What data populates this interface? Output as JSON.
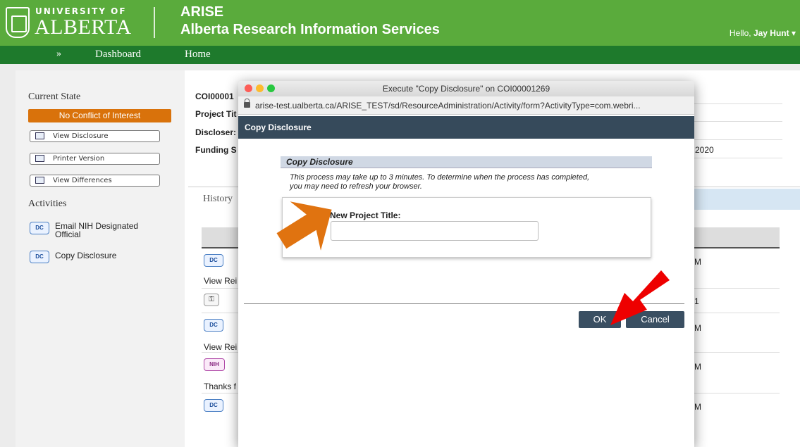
{
  "header": {
    "university_line1": "UNIVERSITY OF",
    "university_line2": "ALBERTA",
    "app_short": "ARISE",
    "app_full": "Alberta Research Information Services",
    "greeting_prefix": "Hello,",
    "user_name": "Jay Hunt",
    "user_menu_icon": "caret-down-icon"
  },
  "nav": {
    "expand_icon": "»",
    "items": [
      "Dashboard",
      "Home"
    ]
  },
  "sidebar": {
    "current_state_label": "Current State",
    "state_value": "No Conflict of Interest",
    "state_color": "#d9720b",
    "buttons": [
      {
        "label": "View Disclosure",
        "icon": "window-icon"
      },
      {
        "label": "Printer Version",
        "icon": "printer-icon"
      },
      {
        "label": "View Differences",
        "icon": "compare-icon"
      }
    ],
    "activities_label": "Activities",
    "activities": [
      {
        "badge": "DC",
        "label": "Email NIH Designated Official"
      },
      {
        "badge": "DC",
        "label": "Copy Disclosure"
      }
    ]
  },
  "background": {
    "info_rows": [
      "COI00001",
      "Project Tit",
      "Discloser:",
      "Funding S"
    ],
    "info_right_value": "2020",
    "history_tab": "History",
    "history_items": [
      {
        "badge": "DC",
        "right": "M"
      },
      {
        "text": "View Rei"
      },
      {
        "badge": "lock",
        "right": "1"
      },
      {
        "badge": "DC",
        "right": "M"
      },
      {
        "text": "View Rei"
      },
      {
        "badge": "NIH",
        "right": "M"
      },
      {
        "text": "Thanks f"
      },
      {
        "badge": "DC",
        "right": "M"
      }
    ]
  },
  "modal": {
    "window_title": "Execute \"Copy Disclosure\" on COI00001269",
    "url": "arise-test.ualberta.ca/ARISE_TEST/sd/ResourceAdministration/Activity/form?ActivityType=com.webri...",
    "header": "Copy Disclosure",
    "section_title": "Copy Disclosure",
    "note_line1": "This process may take up to 3 minutes.  To determine when the process has completed,",
    "note_line2": "you may need to refresh your browser.",
    "field_label": "New Project Title:",
    "field_value": "",
    "ok_label": "OK",
    "cancel_label": "Cancel"
  },
  "colors": {
    "header_green": "#5aab3c",
    "nav_green": "#1e7a2c",
    "modal_header": "#364a5b",
    "arrow_orange": "#e07310",
    "arrow_red": "#ee0000"
  }
}
